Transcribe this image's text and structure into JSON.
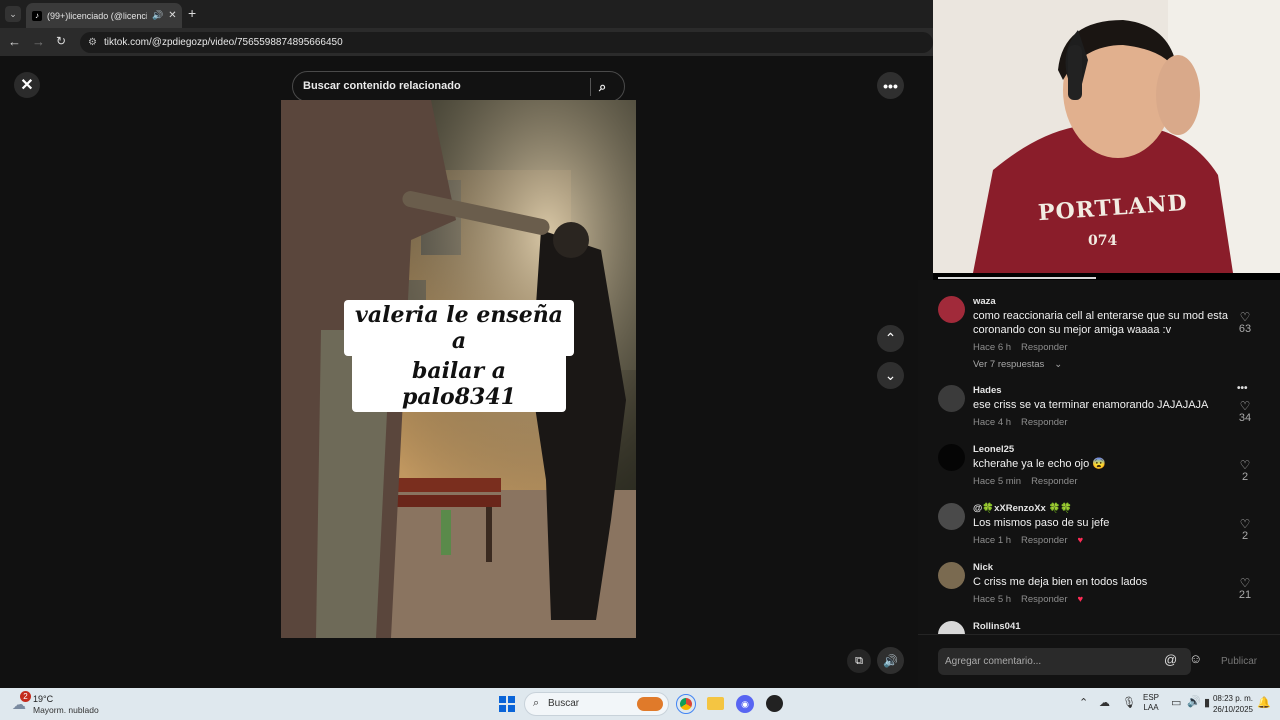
{
  "browser": {
    "tab_title": "(99+)licenciado (@licenciad",
    "url": "tiktok.com/@zpdiegozp/video/7565598874895666450"
  },
  "page": {
    "search_placeholder": "Buscar contenido relacionado",
    "video_caption_line1": "valeria le enseña a",
    "video_caption_line2": "bailar a palo8341"
  },
  "comments": [
    {
      "user": "waza",
      "text": "como reaccionaria cell al enterarse que su mod esta coronando con su mejor amiga waaaa :v",
      "time": "Hace 6 h",
      "reply": "Responder",
      "likes": "63",
      "more_replies": "Ver 7 respuestas"
    },
    {
      "user": "Hades",
      "text": "ese criss se va terminar enamorando JAJAJAJA",
      "time": "Hace 4 h",
      "reply": "Responder",
      "likes": "34"
    },
    {
      "user": "Leonel25",
      "text": "kcherahe ya le echo ojo 😨",
      "time": "Hace 5 min",
      "reply": "Responder",
      "likes": "2"
    },
    {
      "user": "@🍀xXRenzoXx 🍀🍀",
      "text": "Los mismos paso de su jefe",
      "time": "Hace 1 h",
      "reply": "Responder",
      "likes": "2"
    },
    {
      "user": "Nick",
      "text": "C criss me deja bien en todos lados",
      "time": "Hace 5 h",
      "reply": "Responder",
      "likes": "21"
    },
    {
      "user": "Rollins041",
      "text": "",
      "time": "",
      "reply": "",
      "likes": ""
    }
  ],
  "comment_input": {
    "placeholder": "Agregar comentario...",
    "publish": "Publicar"
  },
  "webcam": {
    "sweater_text": "PORTLAND",
    "sweater_number": "074"
  },
  "taskbar": {
    "weather_temp": "19°C",
    "weather_desc": "Mayorm. nublado",
    "weather_badge": "2",
    "search_label": "Buscar",
    "lang": "ESP",
    "lang2": "LAA",
    "time": "08:23 p. m.",
    "date": "26/10/2025"
  },
  "colors": {
    "accent": "#fe2c55",
    "page_bg": "#111111",
    "taskbar_bg": "#dfe8ee"
  }
}
